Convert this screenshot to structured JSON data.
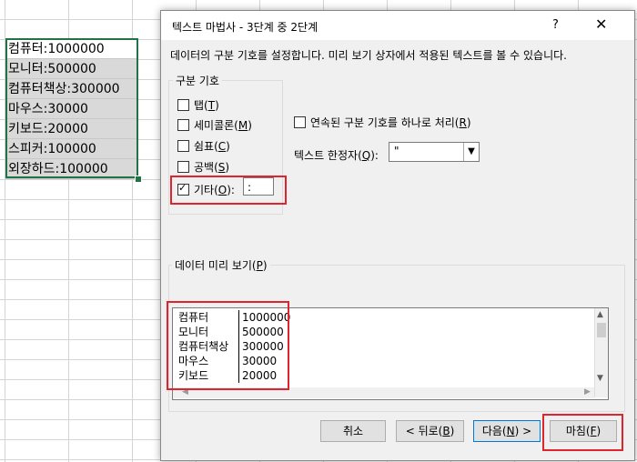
{
  "sheet": {
    "cells": [
      "컴퓨터:1000000",
      "모니터:500000",
      "컴퓨터책상:300000",
      "마우스:30000",
      "키보드:20000",
      "스피커:100000",
      "외장하드:100000"
    ]
  },
  "dialog": {
    "title": "텍스트 마법사 - 3단계 중 2단계",
    "help": "?",
    "close": "✕",
    "instruction": "데이터의 구분 기호를 설정합니다. 미리 보기 상자에서 적용된 텍스트를 볼 수 있습니다.",
    "delimiters": {
      "legend": "구분 기호",
      "tab": {
        "label": "탭",
        "key": "T",
        "checked": false
      },
      "semicolon": {
        "label": "세미콜론",
        "key": "M",
        "checked": false
      },
      "comma": {
        "label": "쉼표",
        "key": "C",
        "checked": false
      },
      "space": {
        "label": "공백",
        "key": "S",
        "checked": false
      },
      "other": {
        "label": "기타",
        "key": "O",
        "checked": true,
        "value": ":"
      }
    },
    "consecutive": {
      "label": "연속된 구분 기호를 하나로 처리",
      "key": "R",
      "checked": false
    },
    "qualifier": {
      "label": "텍스트 한정자",
      "key": "Q",
      "value": "\""
    },
    "preview": {
      "legend": "데이터 미리 보기",
      "key": "P",
      "rows": [
        [
          "컴퓨터",
          "1000000"
        ],
        [
          "모니터",
          "500000"
        ],
        [
          "컴퓨터책상",
          "300000"
        ],
        [
          "마우스",
          "30000"
        ],
        [
          "키보드",
          "20000"
        ]
      ]
    },
    "buttons": {
      "cancel": "취소",
      "back": "< 뒤로",
      "back_key": "B",
      "next": "다음",
      "next_key": "N",
      "next_suffix": " >",
      "finish": "마침",
      "finish_key": "F"
    }
  }
}
